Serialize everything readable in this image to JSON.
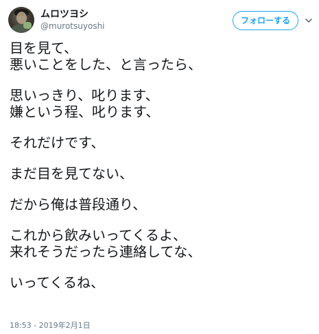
{
  "user": {
    "display_name": "ムロツヨシ",
    "handle": "@murotsuyoshi"
  },
  "follow_button": {
    "label": "フォローする"
  },
  "menu": {
    "icon": "chevron-down-icon"
  },
  "tweet": {
    "paragraphs": [
      [
        "目を見て、",
        "悪いことをした、と言ったら、"
      ],
      [
        "思いっきり、叱ります、",
        "嫌という程、叱ります、"
      ],
      [
        "それだけです、"
      ],
      [
        "まだ目を見てない、"
      ],
      [
        "だから俺は普段通り、"
      ],
      [
        "これから飲みいってくるよ、",
        "来れそうだったら連絡してな、"
      ],
      [
        "いってくるね、"
      ]
    ],
    "timestamp": "18:53 - 2019年2月1日"
  },
  "colors": {
    "accent": "#1da1f2",
    "text": "#14171a",
    "muted": "#657786"
  }
}
